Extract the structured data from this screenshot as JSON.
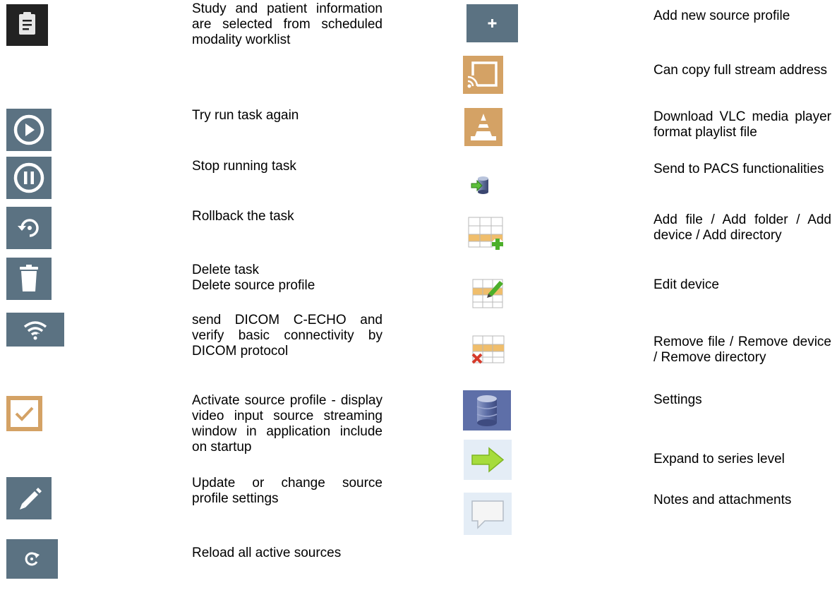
{
  "left_column": [
    {
      "icon": "clipboard-icon",
      "lines": [
        "Study and patient information are selected from scheduled modality worklist"
      ]
    },
    {
      "icon": "play-circle-icon",
      "lines": [
        "Try run task again"
      ]
    },
    {
      "icon": "pause-circle-icon",
      "lines": [
        "Stop running task"
      ]
    },
    {
      "icon": "rollback-icon",
      "lines": [
        "Rollback the task"
      ]
    },
    {
      "icon": "trash-icon",
      "lines": [
        "Delete task",
        "Delete source profile"
      ]
    },
    {
      "icon": "wifi-icon",
      "lines": [
        "send DICOM C-ECHO and verify basic connectivity by DICOM protocol"
      ]
    },
    {
      "icon": "checkbox-checked-icon",
      "lines": [
        "Activate source profile - display video input source streaming window in application include on startup"
      ]
    },
    {
      "icon": "pencil-icon",
      "lines": [
        "Update or change source profile settings"
      ]
    },
    {
      "icon": "reload-icon",
      "lines": [
        "Reload all active sources"
      ]
    }
  ],
  "right_column": [
    {
      "icon": "plus-icon",
      "lines": [
        "Add new source profile"
      ]
    },
    {
      "icon": "cast-icon",
      "lines": [
        "Can copy full stream address"
      ]
    },
    {
      "icon": "vlc-cone-icon",
      "lines": [
        "Download VLC media player format playlist file"
      ]
    },
    {
      "icon": "send-to-pacs-icon",
      "lines": [
        "Send to PACS functionalities"
      ]
    },
    {
      "icon": "table-add-icon",
      "lines": [
        "Add file / Add folder / Add device / Add directory"
      ]
    },
    {
      "icon": "table-edit-icon",
      "lines": [
        "Edit device"
      ]
    },
    {
      "icon": "table-remove-icon",
      "lines": [
        "Remove file / Remove device / Remove directory"
      ]
    },
    {
      "icon": "database-icon",
      "lines": [
        "Settings"
      ]
    },
    {
      "icon": "arrow-right-icon",
      "lines": [
        "Expand to series level"
      ]
    },
    {
      "icon": "speech-bubble-icon",
      "lines": [
        "Notes and attachments"
      ]
    }
  ]
}
